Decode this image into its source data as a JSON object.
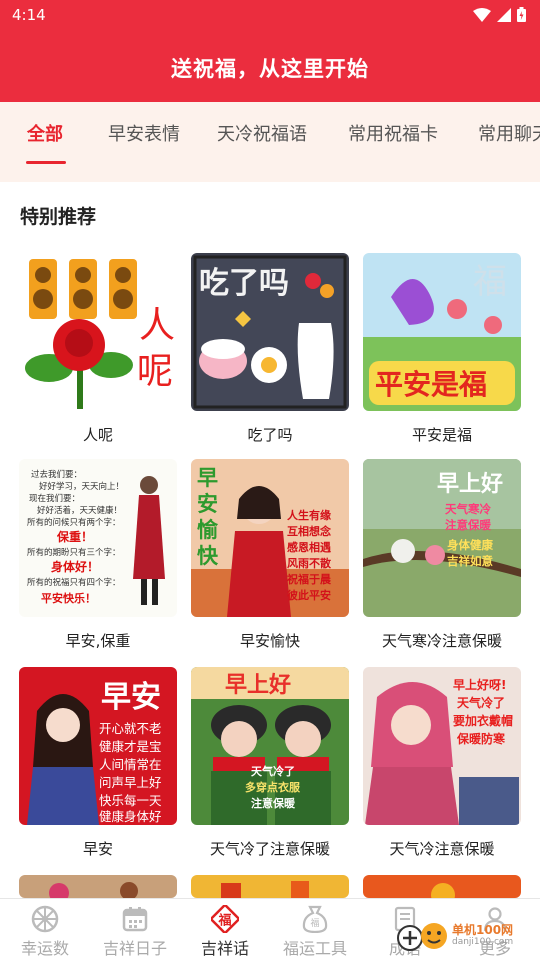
{
  "status_bar": {
    "time": "4:14"
  },
  "header": {
    "title": "送祝福，从这里开始"
  },
  "tabs": [
    {
      "label": "全部",
      "active": true
    },
    {
      "label": "早安表情",
      "active": false
    },
    {
      "label": "天冷祝福语",
      "active": false
    },
    {
      "label": "常用祝福卡",
      "active": false
    },
    {
      "label": "常用聊天",
      "active": false
    }
  ],
  "section": {
    "title": "特别推荐"
  },
  "items": [
    {
      "caption": "人呢",
      "image_text": [
        "人",
        "呢"
      ]
    },
    {
      "caption": "吃了吗",
      "image_text": [
        "吃了吗"
      ]
    },
    {
      "caption": "平安是福",
      "image_text": [
        "平安是福",
        "福"
      ]
    },
    {
      "caption": "早安,保重",
      "image_text": [
        "过去我们要：",
        "好好学习，天天向上！",
        "现在我们要：",
        "好好活着，天天健康！",
        "所有的问候只有两个字：",
        "保重！",
        "所有的期盼只有三个字：",
        "身体好！",
        "所有的祝福只有四个字：",
        "平安快乐！"
      ]
    },
    {
      "caption": "早安愉快",
      "image_text": [
        "早",
        "安",
        "愉",
        "快",
        "人生有缘",
        "互相想念",
        "感恩相遇",
        "风雨不散",
        "祝福于晨",
        "彼此平安"
      ]
    },
    {
      "caption": "天气寒冷注意保暖",
      "image_text": [
        "早上好",
        "天气寒冷",
        "注意保暖",
        "身体健康",
        "吉祥如意"
      ]
    },
    {
      "caption": "早安",
      "image_text": [
        "早安",
        "开心就不老",
        "健康才是宝",
        "人间情常在",
        "问声早上好",
        "快乐每一天",
        "健康身体好"
      ]
    },
    {
      "caption": "天气冷了注意保暖",
      "image_text": [
        "早上好",
        "天气冷了",
        "多穿点衣服",
        "注意保暖"
      ]
    },
    {
      "caption": "天气冷注意保暖",
      "image_text": [
        "早上好呀!",
        "天气冷了",
        "要加衣戴帽",
        "保暖防寒"
      ]
    }
  ],
  "bottom_nav": [
    {
      "label": "幸运数",
      "icon": "wheel-icon",
      "active": false
    },
    {
      "label": "吉祥日子",
      "icon": "calendar-icon",
      "active": false
    },
    {
      "label": "吉祥话",
      "icon": "fu-icon",
      "active": true
    },
    {
      "label": "福运工具",
      "icon": "fortune-bag-icon",
      "active": false
    },
    {
      "label": "成语",
      "icon": "book-icon",
      "active": false
    },
    {
      "label": "更多",
      "icon": "user-icon",
      "active": false
    }
  ],
  "watermark": {
    "text": "单机100网",
    "sub": "danji100.com"
  },
  "colors": {
    "brand": "#eb2d3e",
    "tab_active": "#e8252f",
    "tab_bg": "#fdf2ec",
    "nav_active": "#e02020"
  }
}
